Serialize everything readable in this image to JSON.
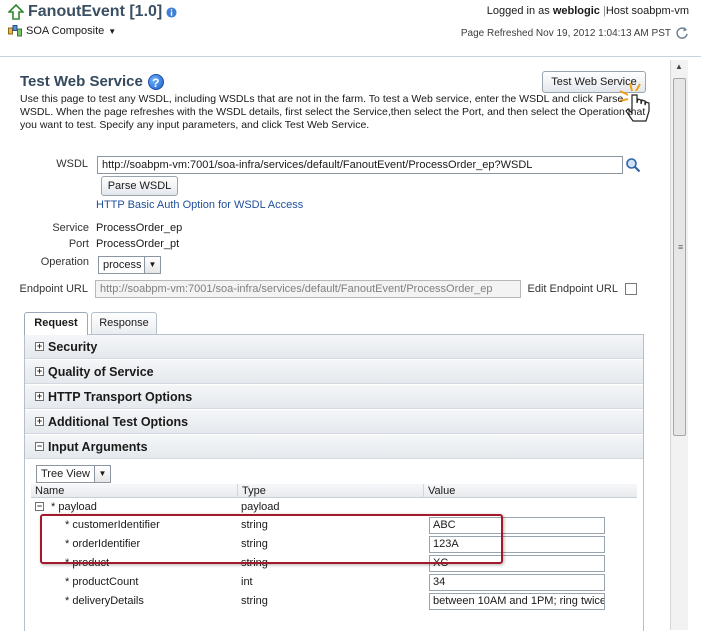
{
  "header": {
    "title": "FanoutEvent [1.0]",
    "composite_menu": "SOA Composite",
    "logged_in_prefix": "Logged in as",
    "user": "weblogic",
    "host_label": "Host",
    "host": "soabpm-vm",
    "refreshed": "Page Refreshed Nov 19, 2012 1:04:13 AM PST"
  },
  "page": {
    "title": "Test Web Service",
    "description": "Use this page to test any WSDL, including WSDLs that are not in the farm. To test a Web service, enter the WSDL and click Parse WSDL. When the page refreshes with the WSDL details, first select the Service,then select the Port, and then select the Operation that you want to test. Specify any input parameters, and click Test Web Service.",
    "test_button": "Test Web Service"
  },
  "form": {
    "wsdl_label": "WSDL",
    "wsdl_value": "http://soabpm-vm:7001/soa-infra/services/default/FanoutEvent/ProcessOrder_ep?WSDL",
    "parse_button": "Parse WSDL",
    "auth_link": "HTTP Basic Auth Option for WSDL Access",
    "service_label": "Service",
    "service_value": "ProcessOrder_ep",
    "port_label": "Port",
    "port_value": "ProcessOrder_pt",
    "operation_label": "Operation",
    "operation_value": "process",
    "endpoint_label": "Endpoint URL",
    "endpoint_value": "http://soabpm-vm:7001/soa-infra/services/default/FanoutEvent/ProcessOrder_ep",
    "edit_endpoint_label": "Edit Endpoint URL"
  },
  "tabs": [
    {
      "label": "Request",
      "active": true
    },
    {
      "label": "Response",
      "active": false
    }
  ],
  "sections": [
    {
      "label": "Security",
      "expanded": false
    },
    {
      "label": "Quality of Service",
      "expanded": false
    },
    {
      "label": "HTTP Transport Options",
      "expanded": false
    },
    {
      "label": "Additional Test Options",
      "expanded": false
    },
    {
      "label": "Input Arguments",
      "expanded": true
    }
  ],
  "input_args": {
    "view_select": "Tree View",
    "columns": [
      "Name",
      "Type",
      "Value"
    ],
    "root": {
      "name": "* payload",
      "type": "payload"
    },
    "rows": [
      {
        "name": "* customerIdentifier",
        "type": "string",
        "value": "ABC"
      },
      {
        "name": "* orderIdentifier",
        "type": "string",
        "value": "123A"
      },
      {
        "name": "* product",
        "type": "string",
        "value": "XC"
      },
      {
        "name": "* productCount",
        "type": "int",
        "value": "34"
      },
      {
        "name": "* deliveryDetails",
        "type": "string",
        "value": "between 10AM and 1PM; ring twice"
      }
    ]
  },
  "colors": {
    "title": "#3b4f63",
    "link": "#1f4f9a",
    "highlight": "#a3182a"
  }
}
